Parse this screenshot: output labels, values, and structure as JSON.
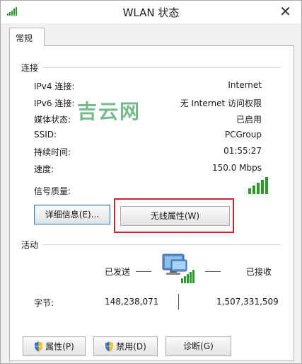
{
  "window": {
    "title": "WLAN 状态",
    "close_glyph": "✕"
  },
  "tabs": [
    {
      "label": "常规"
    }
  ],
  "connection": {
    "section_label": "连接",
    "rows": [
      {
        "label": "IPv4 连接:",
        "value": "Internet"
      },
      {
        "label": "IPv6 连接:",
        "value": "无 Internet 访问权限"
      },
      {
        "label": "媒体状态:",
        "value": "已启用"
      },
      {
        "label": "SSID:",
        "value": "PCGroup"
      },
      {
        "label": "持续时间:",
        "value": "01:55:27"
      },
      {
        "label": "速度:",
        "value": "150.0 Mbps"
      }
    ],
    "signal_label": "信号质量:",
    "signal_bars": 5,
    "details_button": "详细信息(E)...",
    "wireless_props_button": "无线属性(W)"
  },
  "watermark": "吉云网",
  "activity": {
    "section_label": "活动",
    "sent_label": "已发送",
    "received_label": "已接收",
    "bytes_label": "字节:",
    "bytes_sent": "148,238,071",
    "bytes_received": "1,507,331,509"
  },
  "buttons": {
    "properties": "属性(P)",
    "disable": "禁用(D)",
    "diagnose": "诊断(G)"
  },
  "colors": {
    "signal": "#2e9a2e",
    "highlight": "#c8242b",
    "watermark": "#5fae7a"
  }
}
